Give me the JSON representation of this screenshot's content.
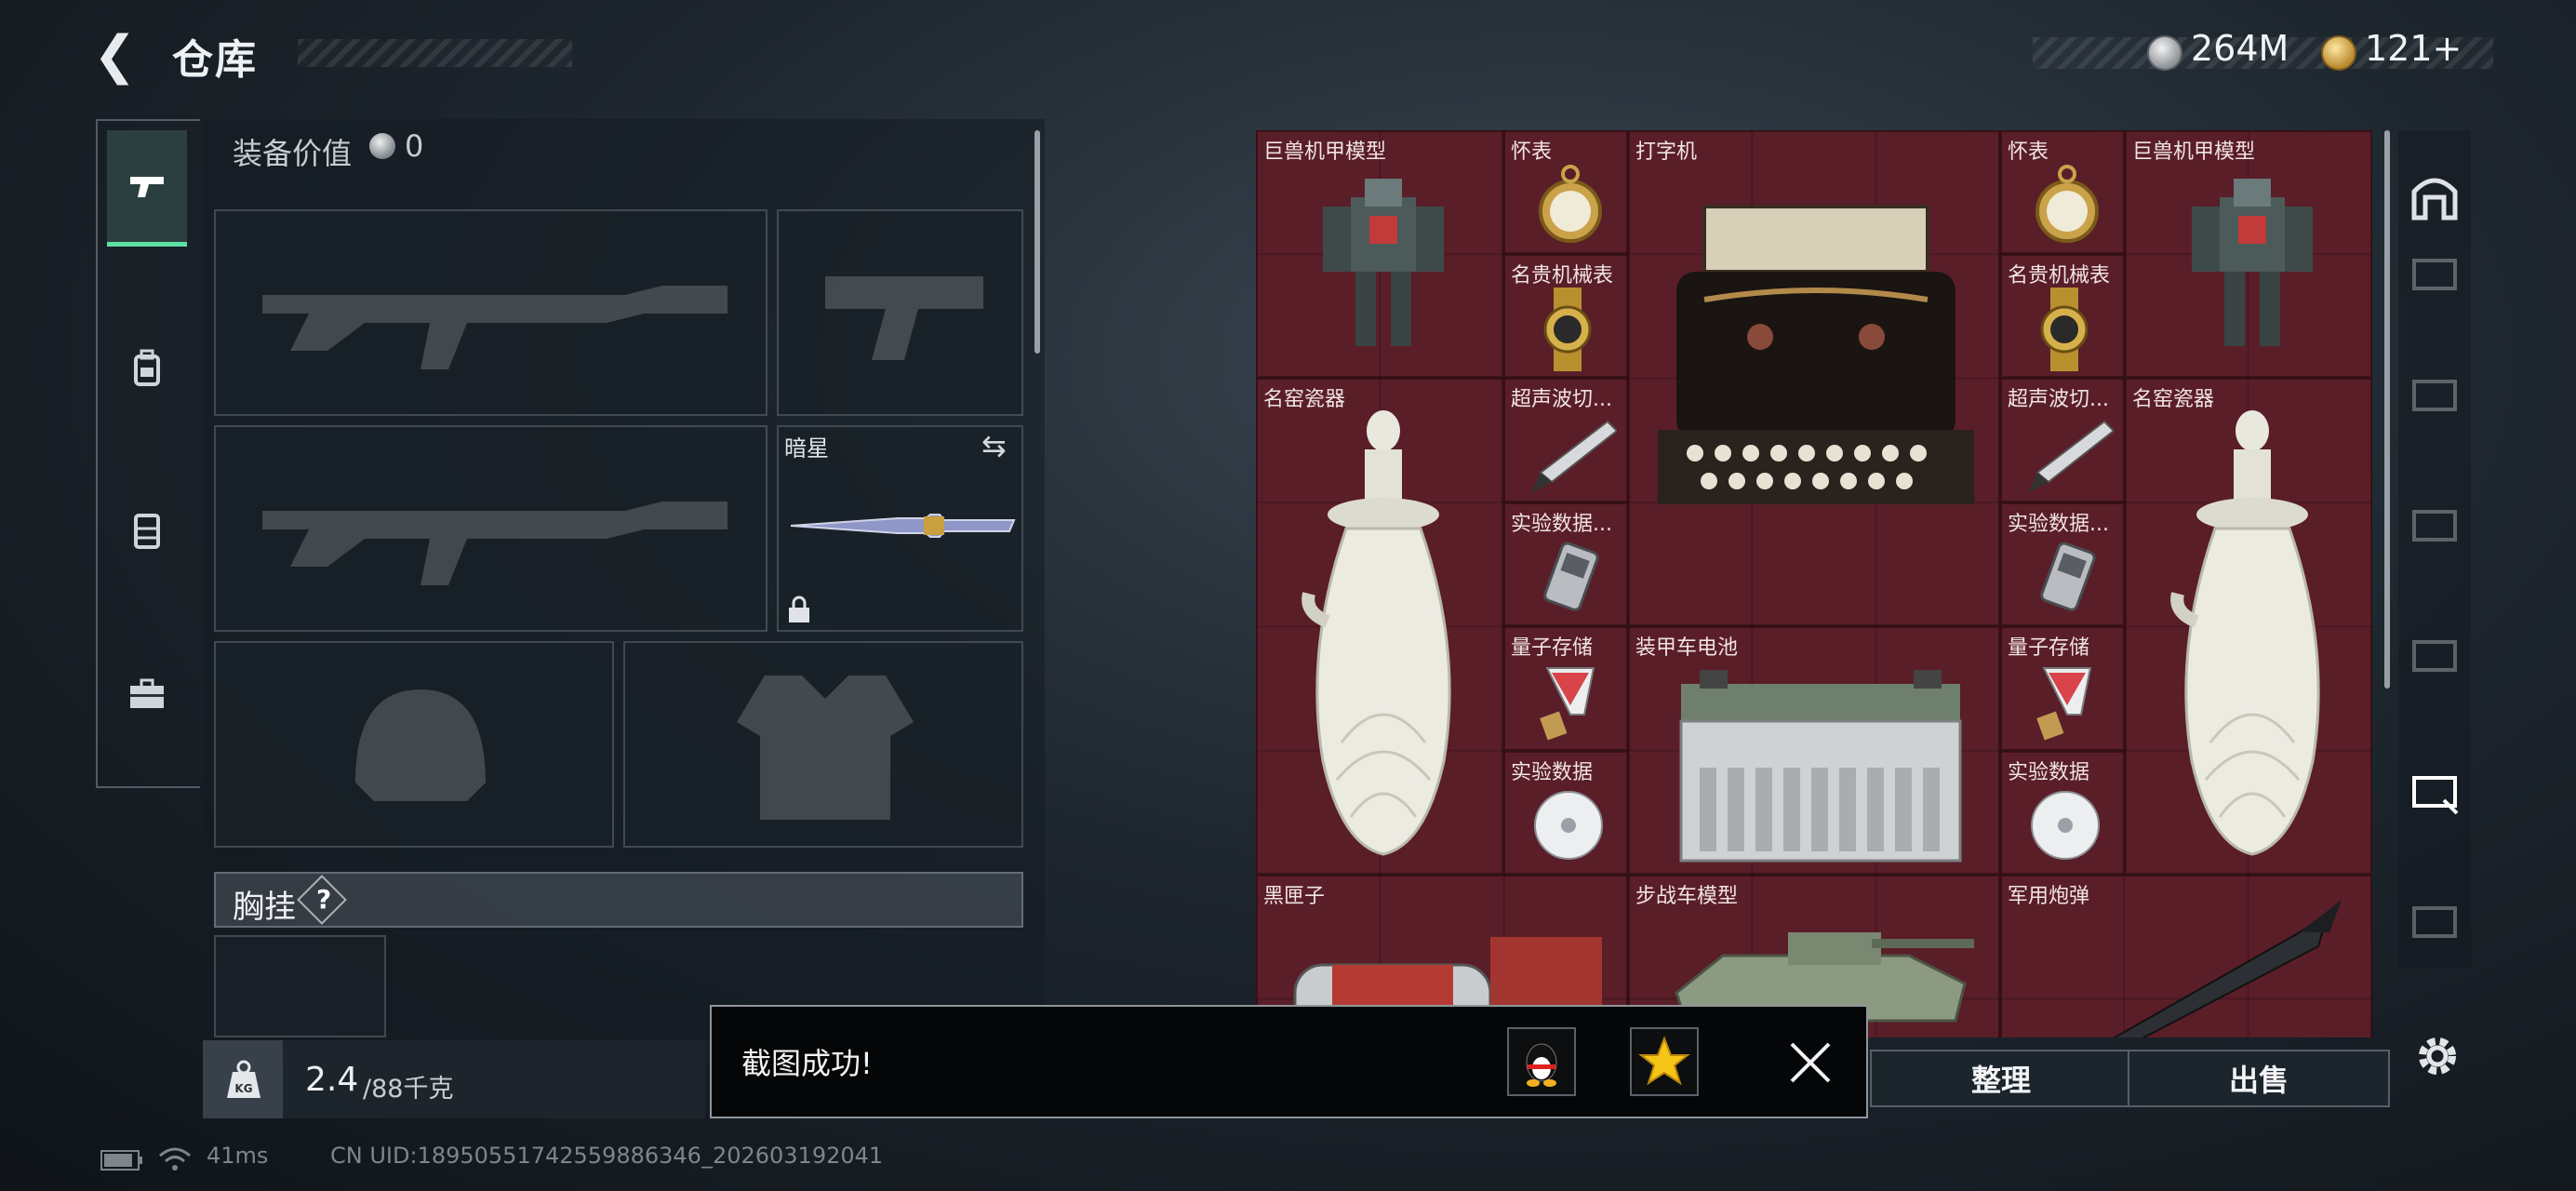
{
  "header": {
    "title": "仓库",
    "back_icon": "back-arrow-icon"
  },
  "currency": {
    "silver": "264M",
    "gold": "121+"
  },
  "loadout": {
    "equip_value_label": "装备价值",
    "equip_value": "0",
    "knife_name": "暗星",
    "chest_label": "胸挂",
    "chest_help": "?"
  },
  "weight": {
    "current": "2.4",
    "max": "/88千克",
    "icon_text": "KG"
  },
  "items": [
    {
      "label": "巨兽机甲模型"
    },
    {
      "label": "怀表"
    },
    {
      "label": "打字机"
    },
    {
      "label": "怀表"
    },
    {
      "label": "巨兽机甲模型"
    },
    {
      "label": "名贵机械表"
    },
    {
      "label": "名贵机械表"
    },
    {
      "label": "名窑瓷器"
    },
    {
      "label": "超声波切..."
    },
    {
      "label": "超声波切..."
    },
    {
      "label": "名窑瓷器"
    },
    {
      "label": "实验数据..."
    },
    {
      "label": "实验数据..."
    },
    {
      "label": "量子存储"
    },
    {
      "label": "装甲车电池"
    },
    {
      "label": "量子存储"
    },
    {
      "label": "实验数据"
    },
    {
      "label": "实验数据"
    },
    {
      "label": "黑匣子"
    },
    {
      "label": "步战车模型"
    },
    {
      "label": "军用炮弹"
    }
  ],
  "actions": {
    "sort": "整理",
    "sell": "出售"
  },
  "toast": {
    "message": "截图成功!"
  },
  "status": {
    "ping": "41ms",
    "uid": "CN UID:18950551742559886346_202603192041"
  },
  "colors": {
    "grid_bg": "#5b1f29",
    "accent_green": "#5ee0a2"
  }
}
